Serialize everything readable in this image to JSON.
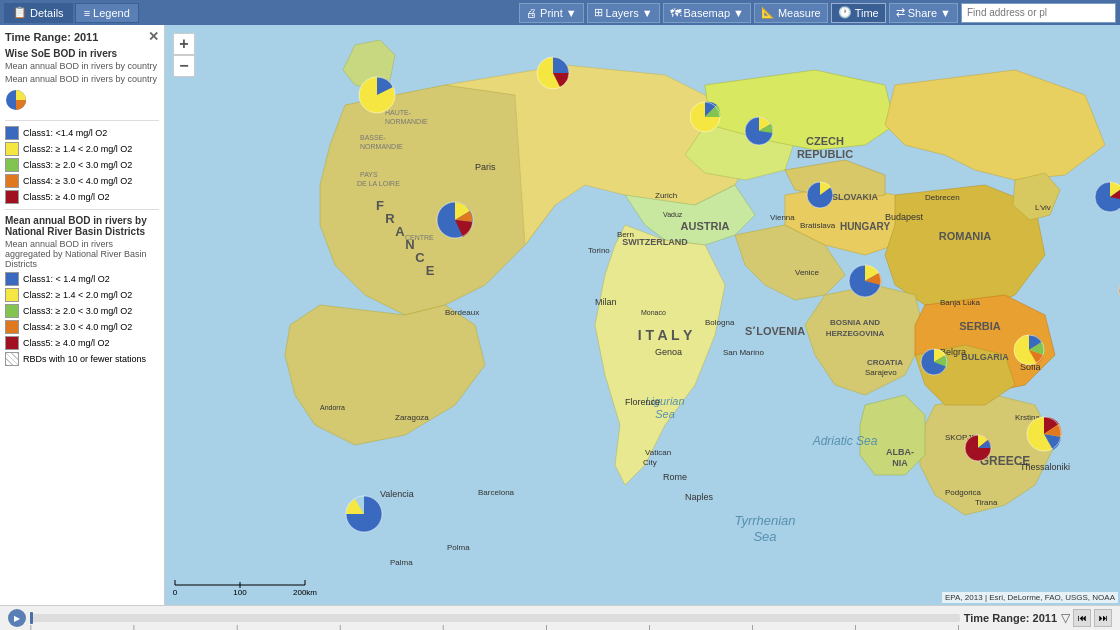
{
  "toolbar": {
    "details_label": "Details",
    "legend_label": "Legend",
    "print_label": "Print",
    "layers_label": "Layers",
    "basemap_label": "Basemap",
    "measure_label": "Measure",
    "time_label": "Time",
    "share_label": "Share",
    "search_placeholder": "Find address or pl"
  },
  "panel": {
    "time_range_label": "Time Range:",
    "time_range_value": "2011",
    "section1_title": "Wise SoE BOD in rivers",
    "section1_sub1": "Mean annual BOD in rivers by country",
    "section1_sub2": "Mean annual BOD in rivers by country",
    "pie_classes": [
      {
        "color": "#3a6abf",
        "label": "Class1: <1.4 mg/l O2"
      },
      {
        "color": "#f5e642",
        "label": "Class2: ≥ 1.4 < 2.0 mg/l O2"
      },
      {
        "color": "#82c450",
        "label": "Class3: ≥ 2.0 < 3.0 mg/l O2"
      },
      {
        "color": "#e07820",
        "label": "Class4: ≥ 3.0 < 4.0 mg/l O2"
      },
      {
        "color": "#a01020",
        "label": "Class5: ≥ 4.0 mg/l O2"
      }
    ],
    "section2_title": "Mean annual BOD in rivers by National River Basin Districts",
    "section2_sub": "Mean annual BOD in rivers aggregated by National River Basin Districts",
    "rbd_classes": [
      {
        "color": "#3a6abf",
        "label": "Class1: < 1.4 mg/l O2"
      },
      {
        "color": "#f5e642",
        "label": "Class2: ≥ 1.4 < 2.0 mg/l O2"
      },
      {
        "color": "#82c450",
        "label": "Class3: ≥ 2.0 < 3.0 mg/l O2"
      },
      {
        "color": "#e07820",
        "label": "Class4: ≥ 3.0 < 4.0 mg/l O2"
      },
      {
        "color": "#a01020",
        "label": "Class5: ≥ 4.0 mg/l O2"
      }
    ],
    "rbd_few_stations": "RBDs with 10 or fewer stations"
  },
  "timeline": {
    "label": "Time Range: 2011"
  },
  "attribution": "EPA, 2013 | Esri, DeLorme, FAO, USGS, NOAA"
}
